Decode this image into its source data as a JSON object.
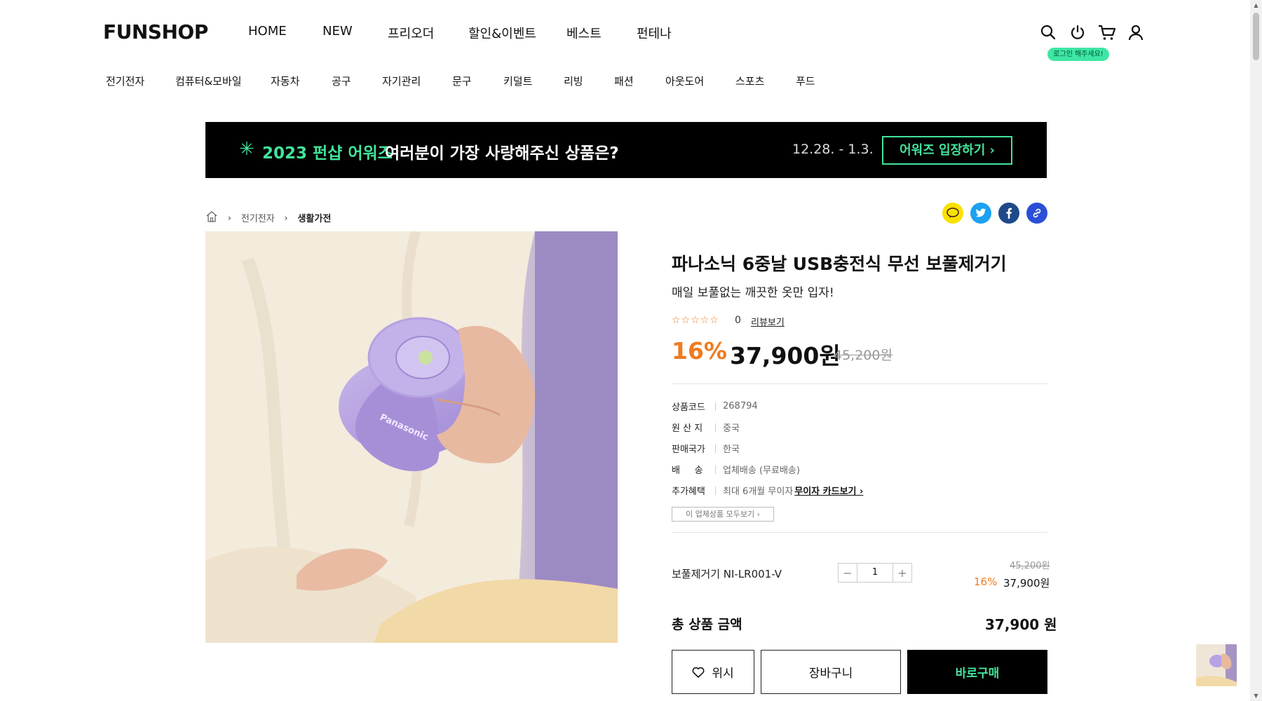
{
  "header": {
    "logo": "FUNSHOP",
    "main_nav": [
      "HOME",
      "NEW",
      "프리오더",
      "할인&이벤트",
      "베스트",
      "펀테나"
    ],
    "category_nav": [
      "전기전자",
      "컴퓨터&모바일",
      "자동차",
      "공구",
      "자기관리",
      "문구",
      "키덜트",
      "리빙",
      "패션",
      "아웃도어",
      "스포츠",
      "푸드"
    ],
    "icons": [
      "search-icon",
      "power-icon",
      "cart-icon",
      "user-icon"
    ],
    "login_badge": "로그인 해주세요!"
  },
  "banner": {
    "star": "✳",
    "highlight": "2023 펀샵 어워즈",
    "text": "여러분이 가장 사랑해주신 상품은?",
    "date": "12.28. - 1.3.",
    "button": "어워즈 입장하기 ›"
  },
  "breadcrumb": {
    "level1": "전기전자",
    "level2": "생활가전"
  },
  "share_icons": [
    "kakao-icon",
    "twitter-icon",
    "facebook-icon",
    "link-icon"
  ],
  "product": {
    "title": "파나소닉 6중날 USB충전식 무선 보풀제거기",
    "subtitle": "매일 보풀없는 깨끗한 옷만 입자!",
    "stars": "☆☆☆☆☆",
    "rating": 5,
    "rating_score": 0,
    "review_count": "0",
    "review_link": "리뷰보기",
    "discount": "16%",
    "price": "37,900원",
    "original_price": "45,200원",
    "image_brand": "Panasonic",
    "specs": [
      {
        "key": "상품코드",
        "value": "268794"
      },
      {
        "key": "원 산 지",
        "value": "중국"
      },
      {
        "key": "판매국가",
        "value": "한국"
      },
      {
        "key": "배     송",
        "value": "업체배송 (무료배송)"
      },
      {
        "key": "추가혜택",
        "value": "최대 6개월 무이자",
        "link": "무이자 카드보기 ›"
      }
    ],
    "vendor_button": "이 업체상품 모두보기 ›"
  },
  "option": {
    "name": "보풀제거기 NI-LR001-V",
    "quantity": "1",
    "minus": "−",
    "plus": "+",
    "original_price": "45,200원",
    "discount": "16%",
    "price": "37,900원"
  },
  "total": {
    "label": "총 상품 금액",
    "value": "37,900 원"
  },
  "actions": {
    "wish": "위시",
    "cart": "장바구니",
    "buy": "바로구매"
  },
  "colors": {
    "accent_green": "#42e39a",
    "accent_orange": "#f07b1e",
    "black": "#000000"
  }
}
